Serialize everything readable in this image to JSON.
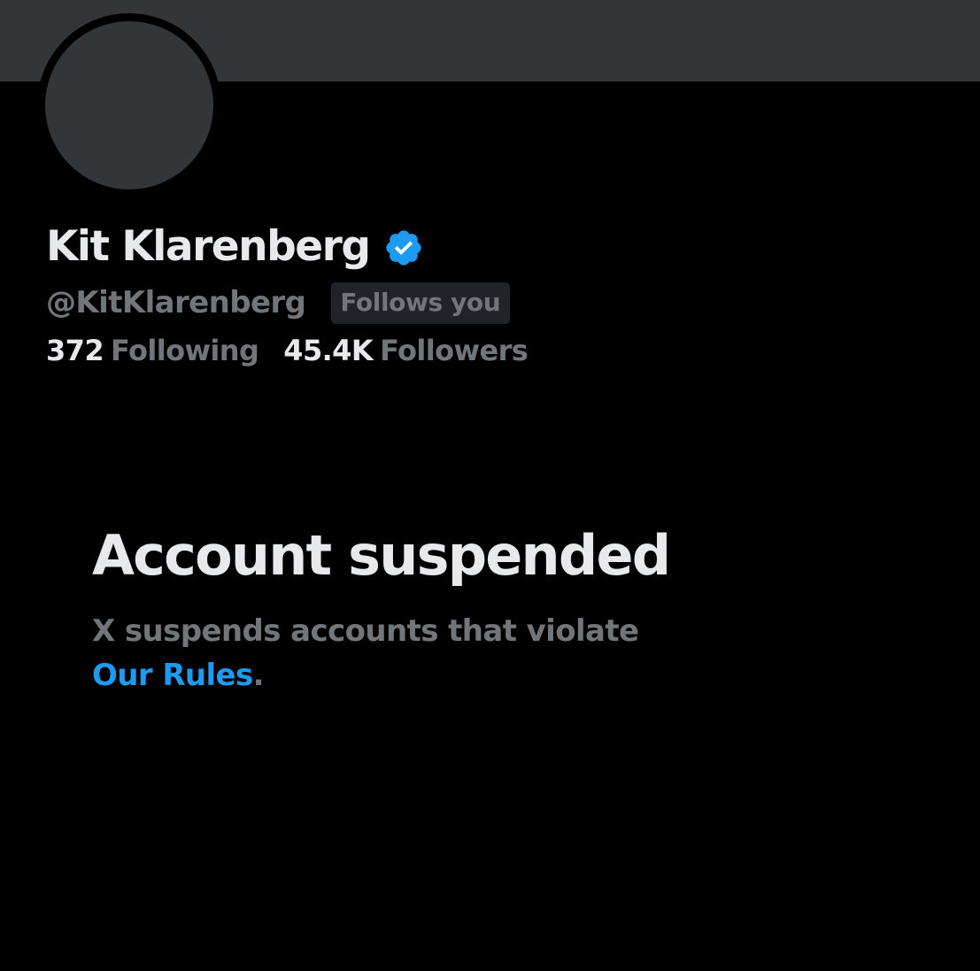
{
  "profile": {
    "display_name": "Kit Klarenberg",
    "verified_icon": "verified-badge-icon",
    "handle": "@KitKlarenberg",
    "follows_you": "Follows you",
    "following_count": "372",
    "following_label": "Following",
    "followers_count": "45.4K",
    "followers_label": "Followers"
  },
  "suspension": {
    "title": "Account suspended",
    "message": "X suspends accounts that violate",
    "link_text": "Our Rules",
    "trailing": "."
  },
  "colors": {
    "background": "#000000",
    "banner": "#333639",
    "primary_text": "#e7e9ea",
    "secondary_text": "#71767b",
    "accent": "#1d9bf0"
  }
}
